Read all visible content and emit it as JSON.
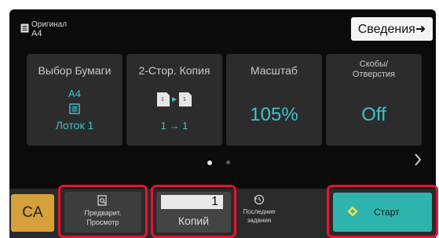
{
  "original": {
    "label": "Оригинал",
    "size": "A4"
  },
  "details_button": "Сведения➜",
  "cards": [
    {
      "title": "Выбор Бумаги",
      "size": "A4",
      "tray": "Лоток 1",
      "icon": "paper-tray-icon"
    },
    {
      "title": "2-Стор. Копия",
      "mode": "1 → 1",
      "icon": "duplex-copy-icon"
    },
    {
      "title": "Масштаб",
      "value": "105%"
    },
    {
      "title_line1": "Скобы/",
      "title_line2": "Отверстия",
      "value": "Off"
    }
  ],
  "pagination": {
    "current": 1,
    "total": 2
  },
  "bottom": {
    "ca_label": "CA",
    "preview": {
      "line1": "Предварит.",
      "line2": "Просмотр",
      "icon": "preview-magnifier-icon"
    },
    "copies": {
      "count": "1",
      "label": "Копий"
    },
    "recent": {
      "line1": "Последние",
      "line2": "задания",
      "icon": "history-clock-icon"
    },
    "start": {
      "label": "Старт",
      "icon": "start-diamond-icon"
    }
  },
  "colors": {
    "accent_teal": "#3cc4cf",
    "start_button": "#2fb3ad",
    "ca_button": "#d6a03a",
    "highlight_red": "#e8122e"
  }
}
